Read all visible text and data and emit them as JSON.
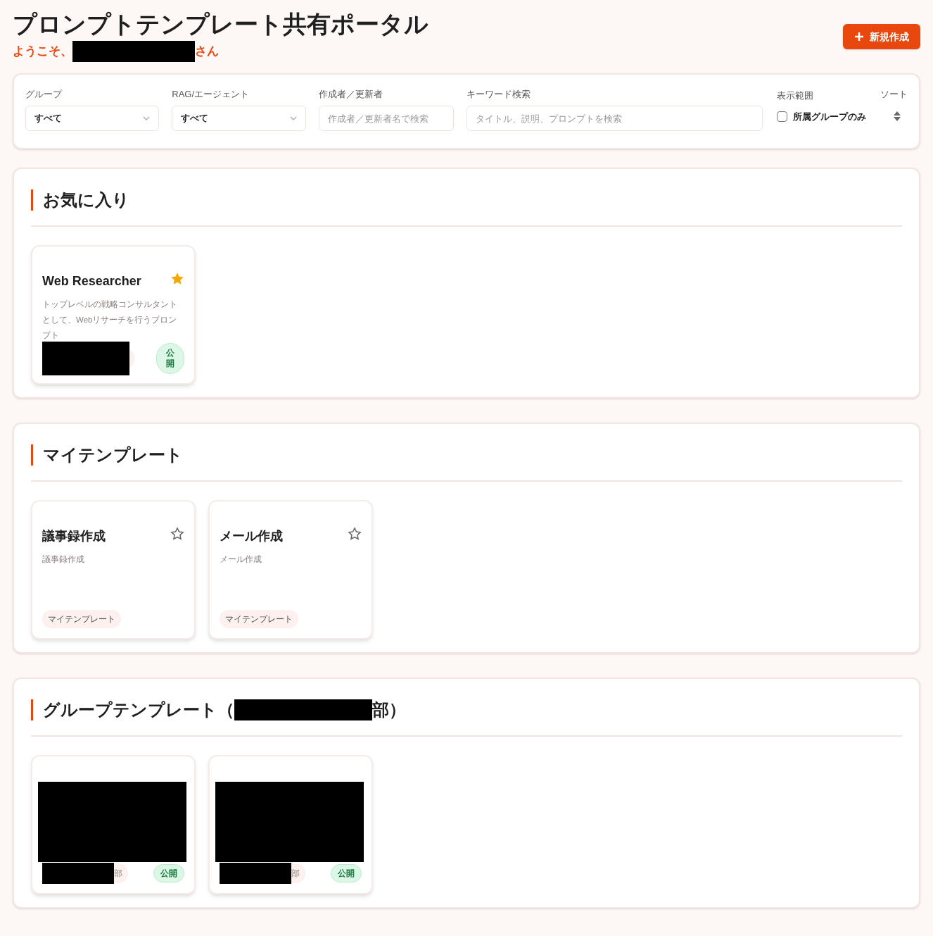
{
  "header": {
    "title": "プロンプトテンプレート共有ポータル",
    "greeting_prefix": "ようこそ、",
    "greeting_suffix": "さん",
    "new_button": "新規作成"
  },
  "filters": {
    "group": {
      "label": "グループ",
      "value": "すべて"
    },
    "rag": {
      "label": "RAG/エージェント",
      "value": "すべて"
    },
    "author": {
      "label": "作成者／更新者",
      "placeholder": "作成者／更新者名で検索"
    },
    "keyword": {
      "label": "キーワード検索",
      "placeholder": "タイトル、説明、プロンプトを検索"
    },
    "scope": {
      "label": "表示範囲",
      "option": "所属グループのみ",
      "checked": false
    },
    "sort": {
      "label": "ソート"
    }
  },
  "sections": [
    {
      "title": "お気に入り",
      "cards": [
        {
          "kind": "full",
          "title": "Web Researcher",
          "description": "トップレベルの戦略コンサルタントとして、Webリサーチを行うプロンプト",
          "favorite": true,
          "tag": {
            "kind": "redacted"
          },
          "public_badge": "公開"
        }
      ]
    },
    {
      "title": "マイテンプレート",
      "cards": [
        {
          "kind": "full",
          "title": "議事録作成",
          "description": "議事録作成",
          "favorite": false,
          "tag": {
            "kind": "plain",
            "text": "マイテンプレート"
          }
        },
        {
          "kind": "full",
          "title": "メール作成",
          "description": "メール作成",
          "favorite": false,
          "tag": {
            "kind": "plain",
            "text": "マイテンプレート"
          }
        }
      ]
    },
    {
      "title": "グループテンプレート（",
      "title_suffix": "部）",
      "cards": [
        {
          "kind": "redacted",
          "tag": {
            "kind": "redacted",
            "text": "部"
          },
          "public_badge": "公開"
        },
        {
          "kind": "redacted",
          "tag": {
            "kind": "redacted",
            "text": "部"
          },
          "public_badge": "公開"
        }
      ]
    }
  ]
}
